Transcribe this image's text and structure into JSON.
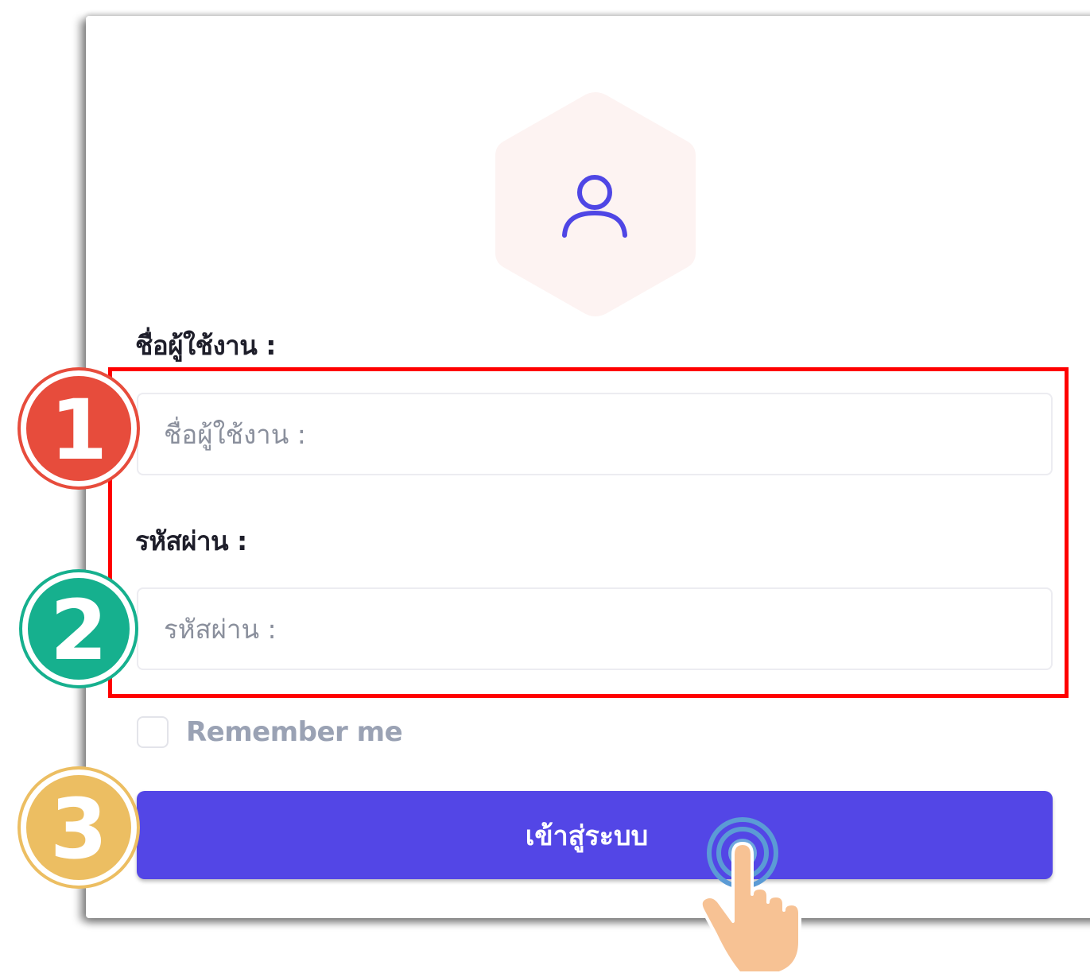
{
  "login_form": {
    "username_label": "ชื่อผู้ใช้งาน :",
    "username_placeholder": "ชื่อผู้ใช้งาน :",
    "password_label": "รหัสผ่าน :",
    "password_placeholder": "รหัสผ่าน :",
    "remember_label": "Remember me",
    "submit_label": "เข้าสู่ระบบ"
  },
  "annotations": {
    "step_1": "1",
    "step_2": "2",
    "step_3": "3"
  },
  "icons": {
    "avatar": "user-icon",
    "cursor": "pointing-hand-icon"
  },
  "colors": {
    "primary": "#5346e6",
    "highlight": "#ff0000",
    "step_1": "#e74c3c",
    "step_2": "#16b08e",
    "step_3": "#ecbe62",
    "hexagon": "#fdf3f2"
  }
}
